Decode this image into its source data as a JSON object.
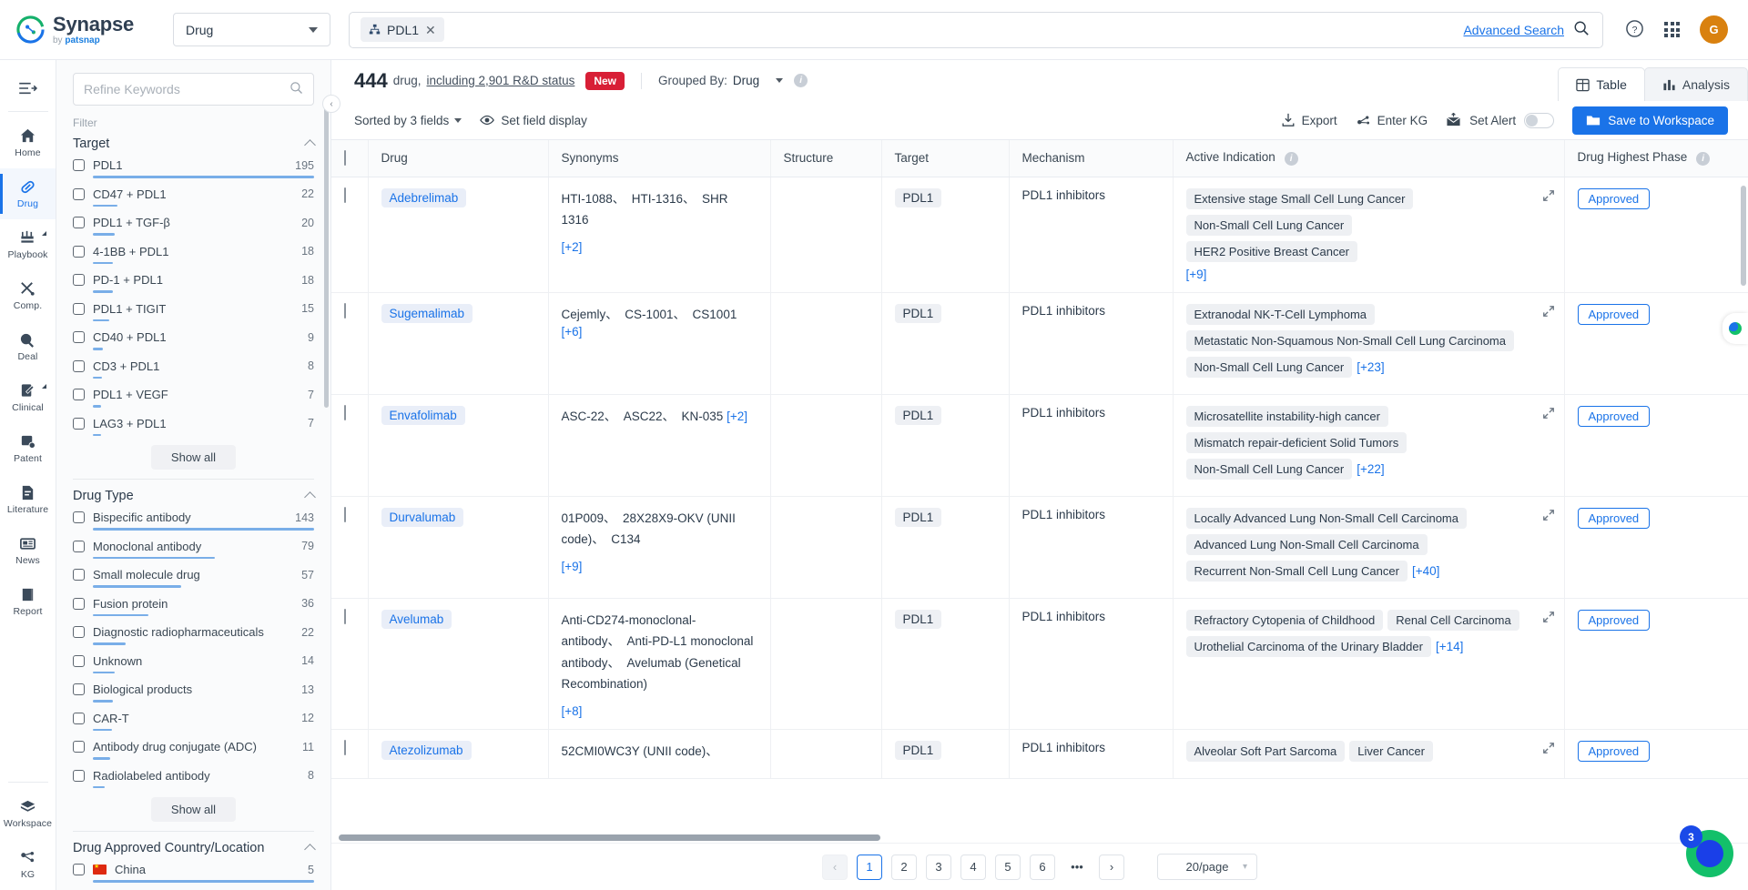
{
  "brand": {
    "name": "Synapse",
    "by": "by",
    "byname": "patsnap"
  },
  "topbar": {
    "entity_select": "Drug",
    "search_chip": "PDL1",
    "advanced_search": "Advanced Search",
    "avatar_initial": "G"
  },
  "rail": {
    "items": [
      {
        "label": "Home",
        "icon": "home-icon",
        "active": false
      },
      {
        "label": "Drug",
        "icon": "capsule-icon",
        "active": true
      },
      {
        "label": "Playbook",
        "icon": "playbook-icon",
        "active": false
      },
      {
        "label": "Comp.",
        "icon": "compare-icon",
        "active": false
      },
      {
        "label": "Deal",
        "icon": "deal-icon",
        "active": false
      },
      {
        "label": "Clinical",
        "icon": "clinical-icon",
        "active": false
      },
      {
        "label": "Patent",
        "icon": "patent-icon",
        "active": false
      },
      {
        "label": "Literature",
        "icon": "literature-icon",
        "active": false
      },
      {
        "label": "News",
        "icon": "news-icon",
        "active": false
      },
      {
        "label": "Report",
        "icon": "report-icon",
        "active": false
      }
    ],
    "bottom": [
      {
        "label": "Workspace",
        "icon": "cube-icon"
      },
      {
        "label": "KG",
        "icon": "knowledge-graph-icon"
      }
    ]
  },
  "filters": {
    "search_placeholder": "Refine Keywords",
    "filter_label": "Filter",
    "show_all": "Show all",
    "sections": [
      {
        "title": "Target",
        "items": [
          {
            "name": "PDL1",
            "count": 195,
            "pct": 100
          },
          {
            "name": "CD47 + PDL1",
            "count": 22,
            "pct": 11
          },
          {
            "name": "PDL1 + TGF-β",
            "count": 20,
            "pct": 10
          },
          {
            "name": "4-1BB + PDL1",
            "count": 18,
            "pct": 9
          },
          {
            "name": "PD-1 + PDL1",
            "count": 18,
            "pct": 9
          },
          {
            "name": "PDL1 + TIGIT",
            "count": 15,
            "pct": 7.5
          },
          {
            "name": "CD40 + PDL1",
            "count": 9,
            "pct": 4.5
          },
          {
            "name": "CD3 + PDL1",
            "count": 8,
            "pct": 4
          },
          {
            "name": "PDL1 + VEGF",
            "count": 7,
            "pct": 3.5
          },
          {
            "name": "LAG3 + PDL1",
            "count": 7,
            "pct": 3.5
          }
        ]
      },
      {
        "title": "Drug Type",
        "items": [
          {
            "name": "Bispecific antibody",
            "count": 143,
            "pct": 100
          },
          {
            "name": "Monoclonal antibody",
            "count": 79,
            "pct": 55
          },
          {
            "name": "Small molecule drug",
            "count": 57,
            "pct": 40
          },
          {
            "name": "Fusion protein",
            "count": 36,
            "pct": 25
          },
          {
            "name": "Diagnostic radiopharmaceuticals",
            "count": 22,
            "pct": 15
          },
          {
            "name": "Unknown",
            "count": 14,
            "pct": 10
          },
          {
            "name": "Biological products",
            "count": 13,
            "pct": 9
          },
          {
            "name": "CAR-T",
            "count": 12,
            "pct": 8.5
          },
          {
            "name": "Antibody drug conjugate (ADC)",
            "count": 11,
            "pct": 8
          },
          {
            "name": "Radiolabeled antibody",
            "count": 8,
            "pct": 5.5
          }
        ]
      },
      {
        "title": "Drug Approved Country/Location",
        "items": [
          {
            "name": "China",
            "count": 5,
            "pct": 100,
            "flag": "china-flag"
          }
        ]
      }
    ]
  },
  "summary": {
    "count": "444",
    "count_word": "drug,",
    "rd_link": "including 2,901 R&D status",
    "new_badge": "New",
    "grouped_by_label": "Grouped By:",
    "grouped_by_value": "Drug"
  },
  "view_tabs": [
    {
      "label": "Table",
      "icon": "table-icon",
      "active": true
    },
    {
      "label": "Analysis",
      "icon": "bar-chart-icon",
      "active": false
    }
  ],
  "actions": {
    "sorted_by": "Sorted by 3 fields",
    "set_field_display": "Set field display",
    "export": "Export",
    "enter_kg": "Enter KG",
    "set_alert": "Set Alert",
    "save_to_workspace": "Save to Workspace"
  },
  "table": {
    "columns": [
      {
        "key": "checkbox",
        "label": ""
      },
      {
        "key": "drug",
        "label": "Drug"
      },
      {
        "key": "synonyms",
        "label": "Synonyms"
      },
      {
        "key": "structure",
        "label": "Structure"
      },
      {
        "key": "target",
        "label": "Target"
      },
      {
        "key": "mechanism",
        "label": "Mechanism"
      },
      {
        "key": "indication",
        "label": "Active Indication",
        "info": true
      },
      {
        "key": "phase",
        "label": "Drug Highest Phase",
        "info": true
      }
    ],
    "rows": [
      {
        "drug": "Adebrelimab",
        "synonyms": [
          "HTI-1088、",
          "HTI-1316、",
          "SHR 1316"
        ],
        "synonyms_more": "[+2]",
        "synonyms_more_newline": true,
        "structure": "",
        "target": "PDL1",
        "mechanism": "PDL1 inhibitors",
        "indications": [
          "Extensive stage Small Cell Lung Cancer",
          "Non-Small Cell Lung Cancer",
          "HER2 Positive Breast Cancer"
        ],
        "indications_more": "[+9]",
        "indications_more_newline": true,
        "phase": "Approved"
      },
      {
        "drug": "Sugemalimab",
        "synonyms": [
          "Cejemly、",
          "CS-1001、",
          "CS1001"
        ],
        "synonyms_more": "[+6]",
        "synonyms_more_newline": false,
        "structure": "",
        "target": "PDL1",
        "mechanism": "PDL1 inhibitors",
        "indications": [
          "Extranodal NK-T-Cell Lymphoma",
          "Metastatic Non-Squamous Non-Small Cell Lung Carcinoma",
          "Non-Small Cell Lung Cancer"
        ],
        "indications_more": "[+23]",
        "indications_more_newline": false,
        "phase": "Approved"
      },
      {
        "drug": "Envafolimab",
        "synonyms": [
          "ASC-22、",
          "ASC22、",
          "KN-035"
        ],
        "synonyms_more": "[+2]",
        "synonyms_more_newline": false,
        "structure": "",
        "target": "PDL1",
        "mechanism": "PDL1 inhibitors",
        "indications": [
          "Microsatellite instability-high cancer",
          "Mismatch repair-deficient Solid Tumors",
          "Non-Small Cell Lung Cancer"
        ],
        "indications_more": "[+22]",
        "indications_more_newline": false,
        "phase": "Approved"
      },
      {
        "drug": "Durvalumab",
        "synonyms": [
          "01P009、",
          "28X28X9-OKV (UNII code)、",
          "C134"
        ],
        "synonyms_more": "[+9]",
        "synonyms_more_newline": true,
        "structure": "",
        "target": "PDL1",
        "mechanism": "PDL1 inhibitors",
        "indications": [
          "Locally Advanced Lung Non-Small Cell Carcinoma",
          "Advanced Lung Non-Small Cell Carcinoma",
          "Recurrent Non-Small Cell Lung Cancer"
        ],
        "indications_more": "[+40]",
        "indications_more_newline": false,
        "phase": "Approved"
      },
      {
        "drug": "Avelumab",
        "synonyms": [
          "Anti-CD274-monoclonal-antibody、",
          "Anti-PD-L1 monoclonal antibody、",
          "Avelumab (Genetical Recombination)"
        ],
        "synonyms_more": "[+8]",
        "synonyms_more_newline": true,
        "structure": "",
        "target": "PDL1",
        "mechanism": "PDL1 inhibitors",
        "indications": [
          "Refractory Cytopenia of Childhood",
          "Renal Cell Carcinoma",
          "Urothelial Carcinoma of the Urinary Bladder"
        ],
        "indications_more": "[+14]",
        "indications_more_newline": false,
        "phase": "Approved"
      },
      {
        "drug": "Atezolizumab",
        "synonyms": [
          "52CMI0WC3Y (UNII code)、"
        ],
        "synonyms_more": "",
        "synonyms_more_newline": false,
        "structure": "",
        "target": "PDL1",
        "mechanism": "PDL1 inhibitors",
        "indications": [
          "Alveolar Soft Part Sarcoma",
          "Liver Cancer"
        ],
        "indications_more": "",
        "indications_more_newline": false,
        "phase": "Approved"
      }
    ]
  },
  "pagination": {
    "prev": "‹",
    "next": "›",
    "pages": [
      "1",
      "2",
      "3",
      "4",
      "5",
      "6"
    ],
    "ellipsis": "•••",
    "active_page": "1",
    "per_page": "20/page"
  },
  "floating": {
    "badge_count": "3"
  },
  "colors": {
    "accent": "#1a73e8",
    "new_badge": "#d81f36",
    "avatar": "#d9810f",
    "bar": "#79aee8"
  }
}
